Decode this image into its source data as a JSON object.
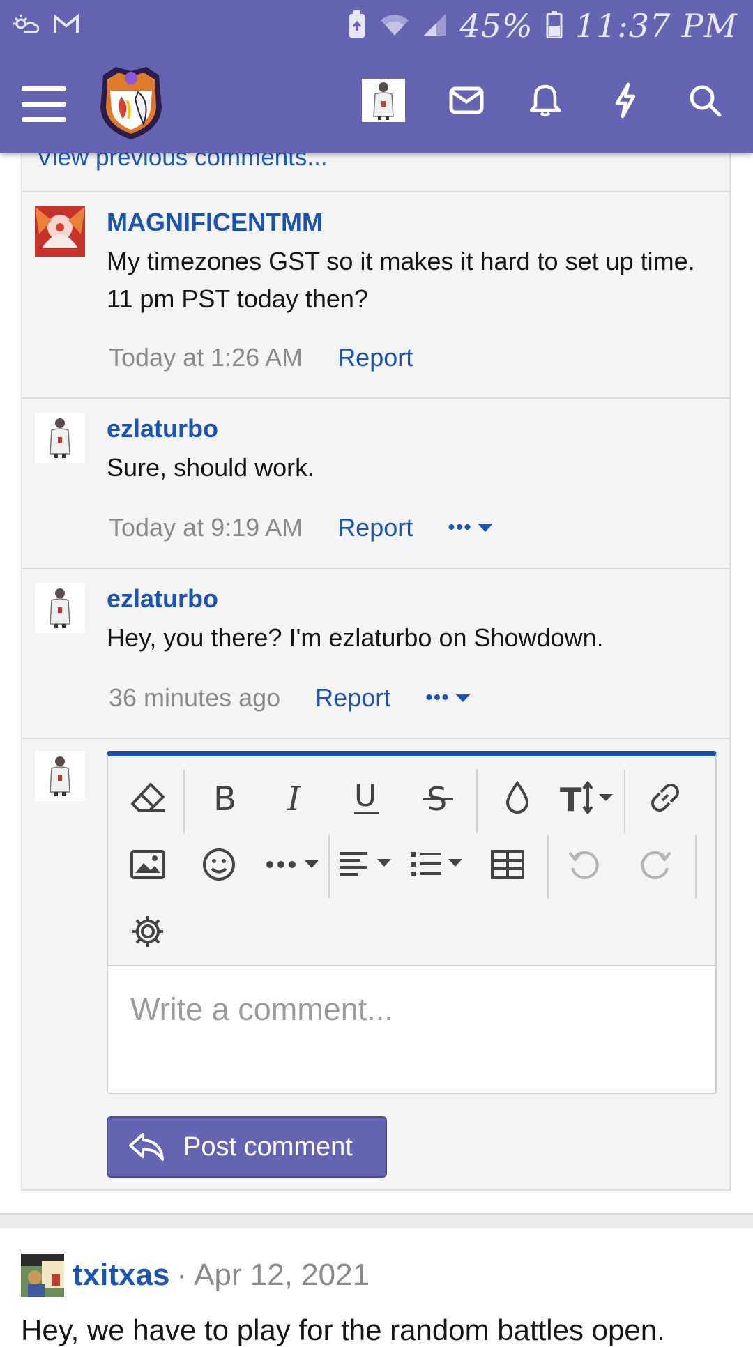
{
  "status_bar": {
    "battery": "45%",
    "time": "11:37 PM",
    "icons": [
      "weather-icon",
      "gmail-icon",
      "battery-saver-icon",
      "wifi-icon",
      "signal-icon",
      "battery-icon"
    ]
  },
  "navbar": {
    "icons": [
      "menu-icon",
      "site-logo",
      "user-avatar",
      "inbox-icon",
      "bell-icon",
      "lightning-icon",
      "search-icon"
    ]
  },
  "thread": {
    "view_previous": "View previous comments...",
    "comments": [
      {
        "user": "MAGNIFICENTMM",
        "body": "My timezones GST so it makes it hard to set up time. 11 pm PST today then?",
        "time": "Today at 1:26 AM",
        "report": "Report"
      },
      {
        "user": "ezlaturbo",
        "body": "Sure, should work.",
        "time": "Today at 9:19 AM",
        "report": "Report",
        "more": "•••"
      },
      {
        "user": "ezlaturbo",
        "body": "Hey, you there? I'm ezlaturbo on Showdown.",
        "time": "36 minutes ago",
        "report": "Report",
        "more": "•••"
      }
    ]
  },
  "editor": {
    "placeholder": "Write a comment...",
    "toolbar": [
      "eraser-icon",
      "bold-icon",
      "italic-icon",
      "underline-icon",
      "strikethrough-icon",
      "color-icon",
      "font-size-icon",
      "link-icon",
      "image-icon",
      "emoji-icon",
      "more-icon",
      "align-icon",
      "list-icon",
      "table-icon",
      "undo-icon",
      "redo-icon",
      "settings-icon"
    ],
    "post_button": "Post comment"
  },
  "next_post": {
    "user": "txitxas",
    "separator": "·",
    "date": "Apr 12, 2021",
    "body": "Hey, we have to play for the random battles open."
  },
  "colors": {
    "header": "#6564b3",
    "link": "#1c55b0",
    "editor_accent": "#1e4fa8"
  }
}
